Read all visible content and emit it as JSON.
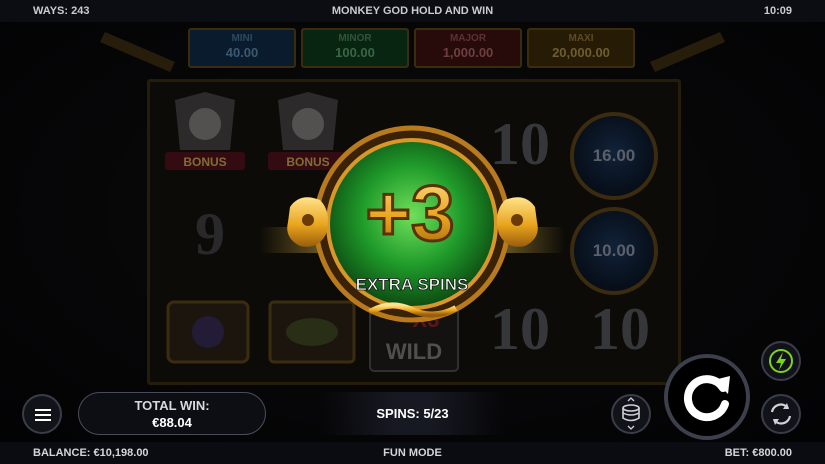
{
  "topbar": {
    "ways": "WAYS: 243",
    "title": "MONKEY GOD HOLD AND WIN",
    "clock": "10:09"
  },
  "jackpots": [
    {
      "label": "MINI",
      "value": "40.00",
      "color": "#5c87ad"
    },
    {
      "label": "MINOR",
      "value": "100.00",
      "color": "#5b9c6a"
    },
    {
      "label": "MAJOR",
      "value": "1,000.00",
      "color": "#a86060"
    },
    {
      "label": "MAXI",
      "value": "20,000.00",
      "color": "#a88c4c"
    }
  ],
  "reels": {
    "bonus_label": "BONUS",
    "coin_values": [
      "16.00",
      "10.00"
    ],
    "wild_multiplier": "X3",
    "wild_label": "WILD"
  },
  "banner": {
    "amount": "+3",
    "text": "EXTRA SPINS",
    "accent": "#2fbf3a",
    "gold": "#e9b12b"
  },
  "controls": {
    "menu_icon": "hamburger-icon",
    "total_win_label": "TOTAL WIN:",
    "total_win_value": "€88.04",
    "spins_label": "SPINS:",
    "spins_value": "5/23",
    "stake_icon": "coin-stack-icon",
    "spin_icon": "spin-arrow-icon",
    "turbo_icon": "lightning-icon",
    "autoplay_icon": "autoplay-icon",
    "turbo_color": "#7ed321"
  },
  "hud": {
    "balance": "BALANCE: €10,198.00",
    "mode": "FUN MODE",
    "bet": "BET: €800.00"
  }
}
